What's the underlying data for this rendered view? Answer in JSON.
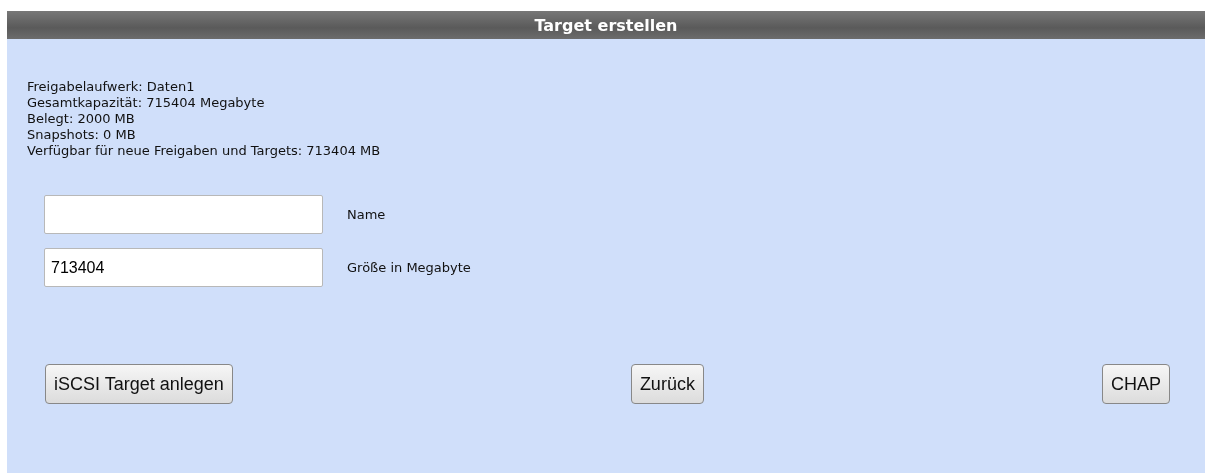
{
  "window": {
    "title": "Target erstellen"
  },
  "info_lines": [
    "Freigabelaufwerk: Daten1",
    "Gesamtkapazität: 715404 Megabyte",
    "Belegt: 2000 MB",
    "Snapshots: 0 MB",
    "Verfügbar für neue Freigaben und Targets: 713404 MB"
  ],
  "fields": [
    {
      "label": "Name"
    },
    {
      "label": "Größe in Megabyte",
      "value": "713404"
    }
  ],
  "buttons": [
    "iSCSI Target anlegen",
    "Zurück",
    "CHAP"
  ]
}
